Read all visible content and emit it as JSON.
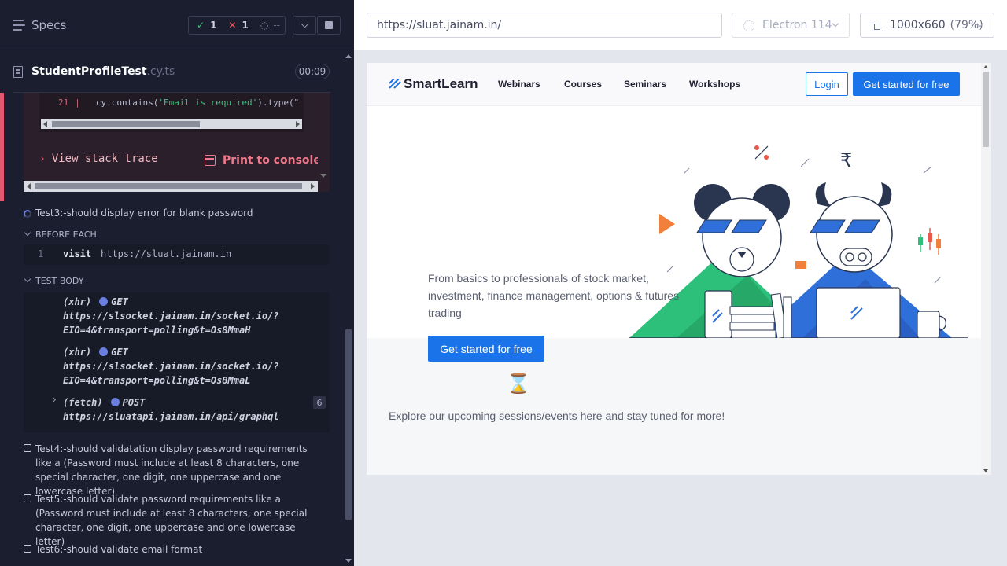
{
  "runner": {
    "specs_title": "Specs",
    "stats": {
      "passed": "1",
      "failed": "1",
      "pending": "--"
    },
    "file": {
      "name": "StudentProfileTest",
      "ext": ".cy.ts"
    },
    "duration": "00:09"
  },
  "error": {
    "line_number": "21",
    "line_sep": "|",
    "code_prefix": "cy.contains(",
    "code_string": "'Email is required'",
    "code_suffix": ").type(\"",
    "stack_link": "View stack trace",
    "print_link": "Print to console"
  },
  "test3": {
    "title": "Test3:-should display error for blank password",
    "before_each": {
      "header": "BEFORE EACH",
      "line": "1",
      "command": "visit",
      "value": "https://sluat.jainam.in"
    },
    "test_body": {
      "header": "TEST BODY",
      "requests": [
        {
          "type": "(xhr)",
          "method": "GET",
          "url_line1": "https://slsocket.jainam.in/socket.io/?",
          "url_line2": "EIO=4&transport=polling&t=Os8MmaH"
        },
        {
          "type": "(xhr)",
          "method": "GET",
          "url_line1": "https://slsocket.jainam.in/socket.io/?",
          "url_line2": "EIO=4&transport=polling&t=Os8MmaL"
        },
        {
          "type": "(fetch)",
          "method": "POST",
          "url_line1": "https://sluatapi.jainam.in/api/graphql",
          "count": "6"
        }
      ]
    }
  },
  "tests": [
    {
      "title": "Test4:-should validatation display password requirements like a (Password must include at least 8 characters, one special character, one digit, one uppercase and one lowercase letter)"
    },
    {
      "title": "Test5:-should validate password requirements like a (Password must include at least 8 characters, one special character, one digit, one uppercase and one lowercase letter)"
    },
    {
      "title": "Test6:-should validate email format"
    }
  ],
  "browser_bar": {
    "url": "https://sluat.jainam.in/",
    "browser": "Electron 114",
    "viewport": "1000x660",
    "scale": "(79%)"
  },
  "app": {
    "logo": "SmartLearn",
    "nav": [
      "Webinars",
      "Courses",
      "Seminars",
      "Workshops"
    ],
    "login": "Login",
    "cta": "Get started for free",
    "hero_text": "From basics to professionals of stock market, investment, finance management, options & futures trading",
    "hero_cta": "Get started for free",
    "hourglass_icon": "⌛",
    "explore": "Explore our upcoming sessions/events here and stay tuned for more!"
  },
  "colors": {
    "runner_bg": "#1b1e2e",
    "pass": "#3fbf82",
    "fail": "#f2606d",
    "error_accent": "#e45770",
    "brand_blue": "#1a73e8",
    "request_dot": "#6b7fe0"
  }
}
